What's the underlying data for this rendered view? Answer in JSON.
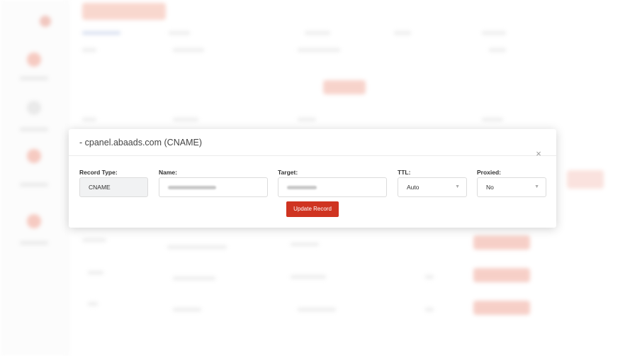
{
  "modal": {
    "title": "- cpanel.abaads.com (CNAME)",
    "close_symbol": "×",
    "fields": {
      "record_type": {
        "label": "Record Type:",
        "value": "CNAME"
      },
      "name": {
        "label": "Name:"
      },
      "target": {
        "label": "Target:"
      },
      "ttl": {
        "label": "TTL:",
        "value": "Auto"
      },
      "proxied": {
        "label": "Proxied:",
        "value": "No"
      }
    },
    "update_label": "Update Record"
  },
  "icons": {
    "close": "close-icon",
    "dropdown": "chevron-down-icon"
  },
  "colors": {
    "accent": "#cf3421",
    "background_accent": "#f0a99b"
  }
}
